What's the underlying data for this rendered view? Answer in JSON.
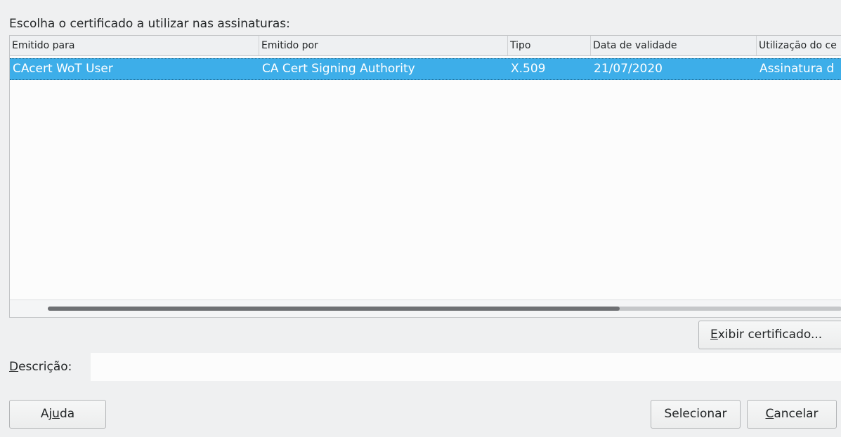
{
  "prompt": "Escolha o certificado a utilizar nas assinaturas:",
  "table": {
    "columns": [
      "Emitido para",
      "Emitido por",
      "Tipo",
      "Data de validade",
      "Utilização do ce"
    ],
    "rows": [
      {
        "issued_to": "CAcert WoT User",
        "issued_by": "CA Cert Signing Authority",
        "type": "X.509",
        "expiration": "21/07/2020",
        "usage": "Assinatura d",
        "selected": true
      }
    ],
    "hscroll_fraction": 0.72
  },
  "buttons": {
    "view_certificate": {
      "accel": "E",
      "rest": "xibir certificado..."
    },
    "help": {
      "pre": "Aj",
      "accel": "u",
      "post": "da"
    },
    "select": "Selecionar",
    "cancel": {
      "accel": "C",
      "rest": "ancelar"
    }
  },
  "description": {
    "label_accel": "D",
    "label_rest": "escrição:",
    "value": ""
  },
  "colors": {
    "selection": "#3daee9",
    "window": "#eff0f1"
  }
}
